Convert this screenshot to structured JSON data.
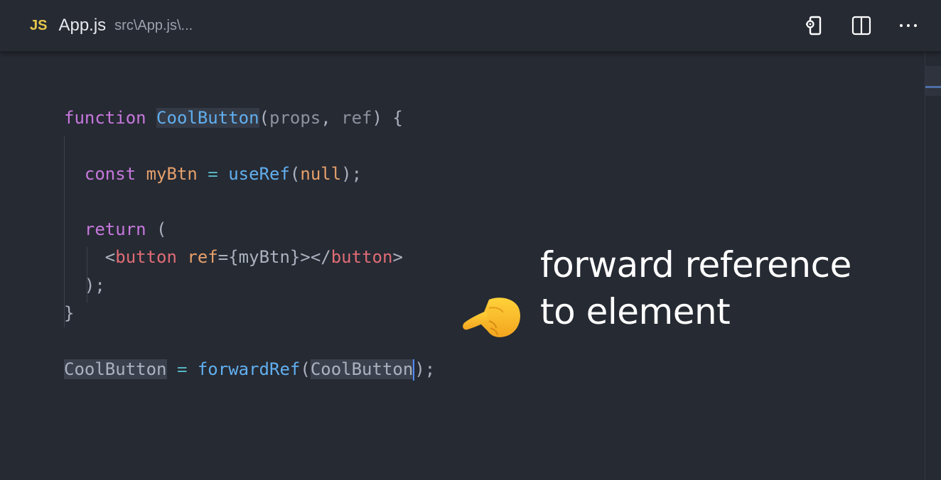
{
  "tab": {
    "language_badge": "JS",
    "file_name": "App.js",
    "file_path": "src\\App.js\\..."
  },
  "actions": [
    {
      "icon": "open-preview-icon"
    },
    {
      "icon": "split-editor-icon"
    },
    {
      "icon": "more-actions-icon"
    }
  ],
  "code": {
    "l1": {
      "kw": "function",
      "name": "CoolButton",
      "open": "(",
      "p1": "props",
      "comma": ", ",
      "p2": "ref",
      "close": ") {"
    },
    "l3": {
      "kw": "const",
      "var": "myBtn",
      "eq": " = ",
      "fn": "useRef",
      "open": "(",
      "arg": "null",
      "close": ");"
    },
    "l5": {
      "kw": "return",
      "rest": " ("
    },
    "l6": {
      "lt": "<",
      "tag": "button",
      "attr": "ref",
      "eq": "=",
      "expr": "{myBtn}",
      "mid": "></",
      "tag2": "button",
      "gt": ">"
    },
    "l7": {
      "text": ");"
    },
    "l8": {
      "text": "}"
    },
    "l10": {
      "name": "CoolButton",
      "eq": " = ",
      "fn": "forwardRef",
      "open": "(",
      "arg": "CoolButton",
      "close": ");"
    }
  },
  "annotation": {
    "line1": "forward reference",
    "line2": "to element"
  },
  "colors": {
    "background": "#262a33",
    "keyword": "#c678dd",
    "function": "#61afef",
    "variable": "#e5a06b",
    "tag": "#e06c75",
    "cursor": "#528bff"
  }
}
